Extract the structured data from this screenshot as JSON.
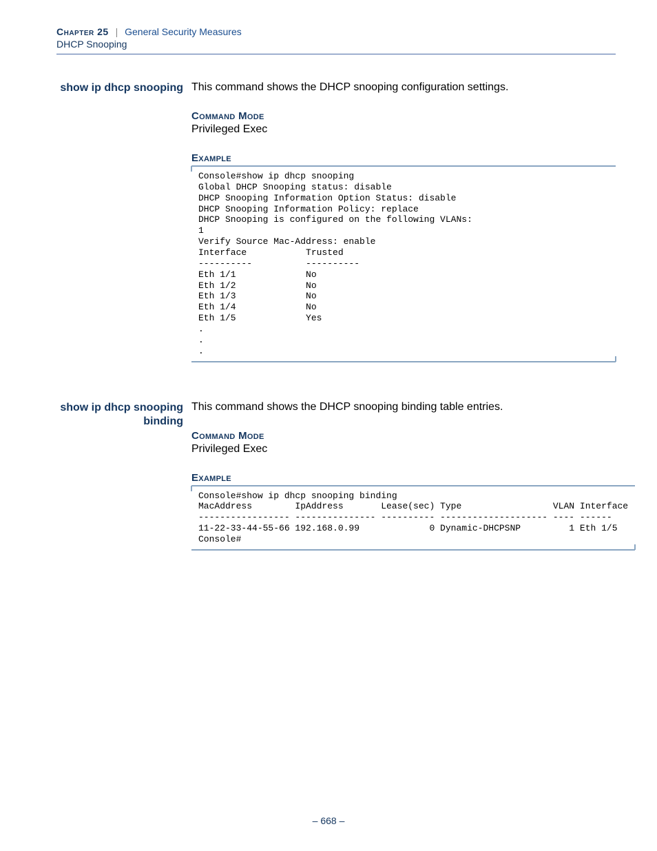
{
  "header": {
    "chapter_label": "Chapter 25",
    "separator": "|",
    "chapter_title": "General Security Measures",
    "subtitle": "DHCP Snooping"
  },
  "sections": [
    {
      "cmd_name": "show ip dhcp snooping",
      "description": "This command shows the DHCP snooping configuration settings.",
      "mode_heading": "Command Mode",
      "mode_text": "Privileged Exec",
      "example_heading": "Example",
      "console": "Console#show ip dhcp snooping\nGlobal DHCP Snooping status: disable\nDHCP Snooping Information Option Status: disable\nDHCP Snooping Information Policy: replace\nDHCP Snooping is configured on the following VLANs:\n1\nVerify Source Mac-Address: enable\nInterface           Trusted\n----------          ----------\nEth 1/1             No\nEth 1/2             No\nEth 1/3             No\nEth 1/4             No\nEth 1/5             Yes\n.\n.\n."
    },
    {
      "cmd_name": "show ip dhcp snooping binding",
      "description": "This command shows the DHCP snooping binding table entries.",
      "mode_heading": "Command Mode",
      "mode_text": "Privileged Exec",
      "example_heading": "Example",
      "console": "Console#show ip dhcp snooping binding\nMacAddress        IpAddress       Lease(sec) Type                 VLAN Interface\n----------------- --------------- ---------- -------------------- ---- ------\n11-22-33-44-55-66 192.168.0.99             0 Dynamic-DHCPSNP         1 Eth 1/5\nConsole#"
    }
  ],
  "footer": {
    "page_number": "– 668 –"
  }
}
